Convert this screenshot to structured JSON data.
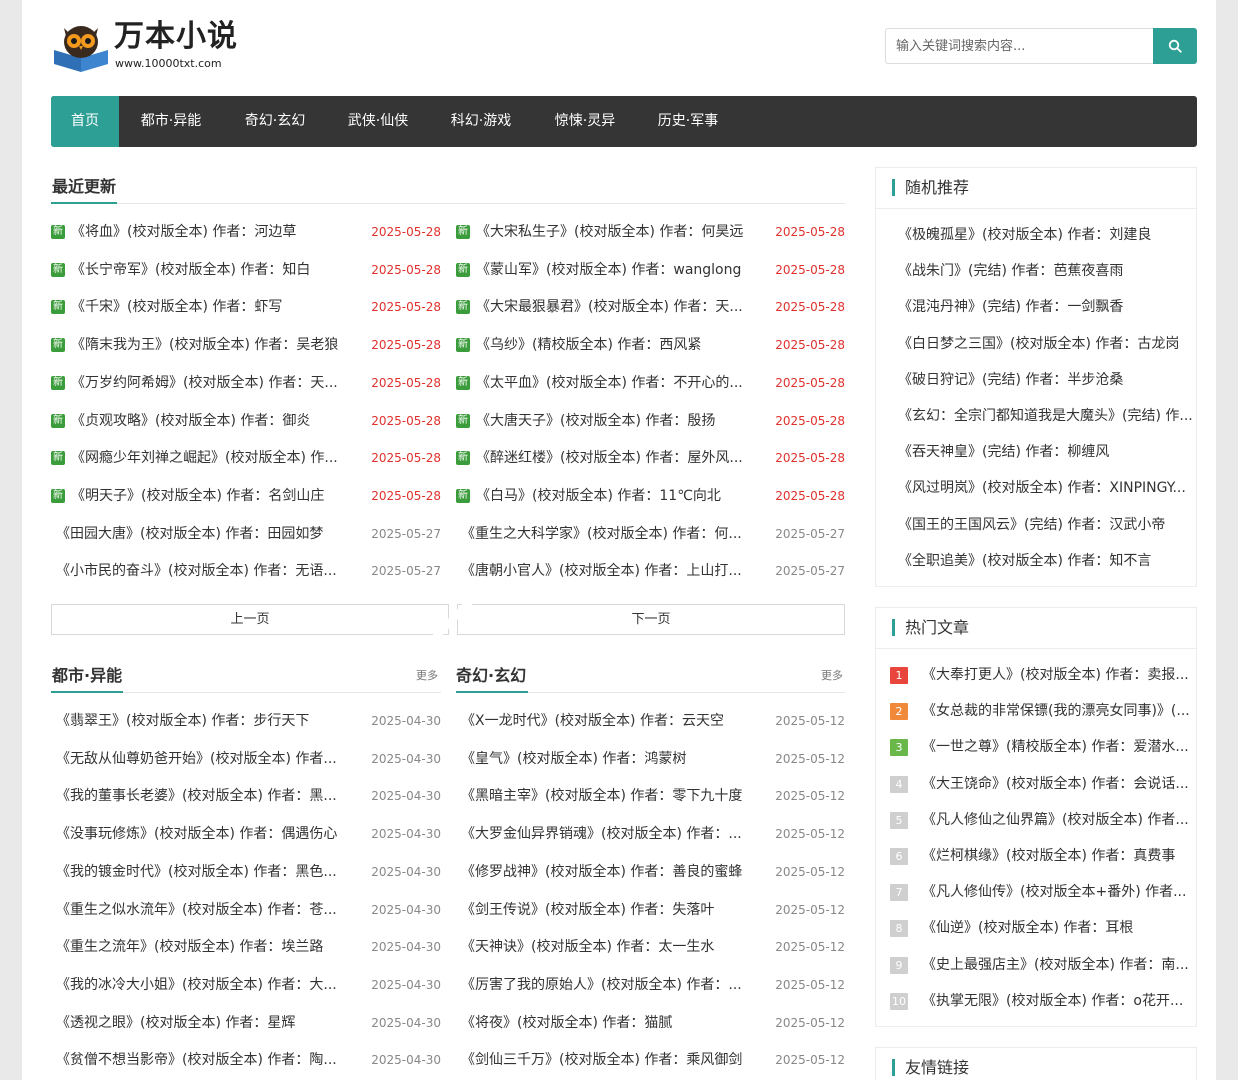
{
  "header": {
    "logo_title": "万本小说",
    "logo_url": "www.10000txt.com",
    "search_placeholder": "输入关键词搜索内容...",
    "colors": {
      "accent": "#2d9f94",
      "nav_bg": "#353535",
      "new_badge": "#3b9c3b",
      "date_red": "#e0312c"
    }
  },
  "nav": [
    {
      "label": "首页",
      "active": true
    },
    {
      "label": "都市·异能"
    },
    {
      "label": "奇幻·玄幻"
    },
    {
      "label": "武侠·仙侠"
    },
    {
      "label": "科幻·游戏"
    },
    {
      "label": "惊悚·灵异"
    },
    {
      "label": "历史·军事"
    }
  ],
  "recent": {
    "title": "最近更新",
    "badge": "新",
    "left": [
      {
        "title": "《将血》(校对版全本) 作者：河边草",
        "date": "2025-05-28",
        "new": true
      },
      {
        "title": "《长宁帝军》(校对版全本) 作者：知白",
        "date": "2025-05-28",
        "new": true
      },
      {
        "title": "《千宋》(校对版全本) 作者：虾写",
        "date": "2025-05-28",
        "new": true
      },
      {
        "title": "《隋末我为王》(校对版全本) 作者：吴老狼",
        "date": "2025-05-28",
        "new": true
      },
      {
        "title": "《万岁约阿希姆》(校对版全本) 作者：天...",
        "date": "2025-05-28",
        "new": true
      },
      {
        "title": "《贞观攻略》(校对版全本) 作者：御炎",
        "date": "2025-05-28",
        "new": true
      },
      {
        "title": "《网瘾少年刘禅之崛起》(校对版全本) 作...",
        "date": "2025-05-28",
        "new": true
      },
      {
        "title": "《明天子》(校对版全本) 作者：名剑山庄",
        "date": "2025-05-28",
        "new": true
      },
      {
        "title": "《田园大唐》(校对版全本) 作者：田园如梦",
        "date": "2025-05-27",
        "new": false
      },
      {
        "title": "《小市民的奋斗》(校对版全本) 作者：无语...",
        "date": "2025-05-27",
        "new": false
      }
    ],
    "right": [
      {
        "title": "《大宋私生子》(校对版全本) 作者：何昊远",
        "date": "2025-05-28",
        "new": true
      },
      {
        "title": "《蒙山军》(校对版全本) 作者：wanglong",
        "date": "2025-05-28",
        "new": true
      },
      {
        "title": "《大宋最狠暴君》(校对版全本) 作者：天...",
        "date": "2025-05-28",
        "new": true
      },
      {
        "title": "《乌纱》(精校版全本) 作者：西风紧",
        "date": "2025-05-28",
        "new": true
      },
      {
        "title": "《太平血》(校对版全本) 作者：不开心的...",
        "date": "2025-05-28",
        "new": true
      },
      {
        "title": "《大唐天子》(校对版全本) 作者：殷扬",
        "date": "2025-05-28",
        "new": true
      },
      {
        "title": "《醉迷红楼》(校对版全本) 作者：屋外风...",
        "date": "2025-05-28",
        "new": true
      },
      {
        "title": "《白马》(校对版全本) 作者：11℃向北",
        "date": "2025-05-28",
        "new": true
      },
      {
        "title": "《重生之大科学家》(校对版全本) 作者：何...",
        "date": "2025-05-27",
        "new": false
      },
      {
        "title": "《唐朝小官人》(校对版全本) 作者：上山打...",
        "date": "2025-05-27",
        "new": false
      }
    ],
    "prev_label": "上一页",
    "next_label": "下一页"
  },
  "urban": {
    "title": "都市·异能",
    "more": "更多",
    "items": [
      {
        "title": "《翡翠王》(校对版全本) 作者：步行天下",
        "date": "2025-04-30"
      },
      {
        "title": "《无敌从仙尊奶爸开始》(校对版全本) 作者...",
        "date": "2025-04-30"
      },
      {
        "title": "《我的董事长老婆》(校对版全本) 作者：黑...",
        "date": "2025-04-30"
      },
      {
        "title": "《没事玩修炼》(校对版全本) 作者：偶遇伤心",
        "date": "2025-04-30"
      },
      {
        "title": "《我的镀金时代》(校对版全本) 作者：黑色...",
        "date": "2025-04-30"
      },
      {
        "title": "《重生之似水流年》(校对版全本) 作者：苍...",
        "date": "2025-04-30"
      },
      {
        "title": "《重生之流年》(校对版全本) 作者：埃兰路",
        "date": "2025-04-30"
      },
      {
        "title": "《我的冰冷大小姐》(校对版全本) 作者：大...",
        "date": "2025-04-30"
      },
      {
        "title": "《透视之眼》(校对版全本) 作者：星辉",
        "date": "2025-04-30"
      },
      {
        "title": "《贫僧不想当影帝》(校对版全本) 作者：陶...",
        "date": "2025-04-30"
      }
    ]
  },
  "fantasy": {
    "title": "奇幻·玄幻",
    "more": "更多",
    "items": [
      {
        "title": "《X一龙时代》(校对版全本) 作者：云天空",
        "date": "2025-05-12"
      },
      {
        "title": "《皇气》(校对版全本) 作者：鸿蒙树",
        "date": "2025-05-12"
      },
      {
        "title": "《黑暗主宰》(校对版全本) 作者：零下九十度",
        "date": "2025-05-12"
      },
      {
        "title": "《大罗金仙异界销魂》(校对版全本) 作者：...",
        "date": "2025-05-12"
      },
      {
        "title": "《修罗战神》(校对版全本) 作者：善良的蜜蜂",
        "date": "2025-05-12"
      },
      {
        "title": "《剑王传说》(校对版全本) 作者：失落叶",
        "date": "2025-05-12"
      },
      {
        "title": "《天神诀》(校对版全本) 作者：太一生水",
        "date": "2025-05-12"
      },
      {
        "title": "《厉害了我的原始人》(校对版全本) 作者：...",
        "date": "2025-05-12"
      },
      {
        "title": "《将夜》(校对版全本) 作者：猫腻",
        "date": "2025-05-12"
      },
      {
        "title": "《剑仙三千万》(校对版全本) 作者：乘风御剑",
        "date": "2025-05-12"
      }
    ]
  },
  "random": {
    "title": "随机推荐",
    "items": [
      "《极魄孤星》(校对版全本) 作者：刘建良",
      "《战朱门》(完结) 作者：芭蕉夜喜雨",
      "《混沌丹神》(完结) 作者：一剑飘香",
      "《白日梦之三国》(校对版全本) 作者：古龙岗",
      "《破日狩记》(完结) 作者：半步沧桑",
      "《玄幻：全宗门都知道我是大魔头》(完结) 作...",
      "《吞天神皇》(完结) 作者：柳缠风",
      "《风过明岚》(校对版全本) 作者：XINPINGY...",
      "《国王的王国风云》(完结) 作者：汉武小帝",
      "《全职追美》(校对版全本) 作者：知不言"
    ]
  },
  "hot": {
    "title": "热门文章",
    "items": [
      {
        "rank": "1",
        "title": "《大奉打更人》(校对版全本) 作者：卖报...",
        "color": "#e8453c"
      },
      {
        "rank": "2",
        "title": "《女总裁的非常保镖(我的漂亮女同事)》(...",
        "color": "#f08a3a"
      },
      {
        "rank": "3",
        "title": "《一世之尊》(精校版全本) 作者：爱潜水...",
        "color": "#6ab84a"
      },
      {
        "rank": "4",
        "title": "《大王饶命》(校对版全本) 作者：会说话...",
        "color": "#cfcfcf"
      },
      {
        "rank": "5",
        "title": "《凡人修仙之仙界篇》(校对版全本) 作者...",
        "color": "#cfcfcf"
      },
      {
        "rank": "6",
        "title": "《烂柯棋缘》(校对版全本) 作者：真费事",
        "color": "#cfcfcf"
      },
      {
        "rank": "7",
        "title": "《凡人修仙传》(校对版全本+番外) 作者...",
        "color": "#cfcfcf"
      },
      {
        "rank": "8",
        "title": "《仙逆》(校对版全本) 作者：耳根",
        "color": "#cfcfcf"
      },
      {
        "rank": "9",
        "title": "《史上最强店主》(校对版全本) 作者：南...",
        "color": "#cfcfcf"
      },
      {
        "rank": "10",
        "title": "《执掌无限》(校对版全本) 作者：o花开...",
        "color": "#cfcfcf"
      }
    ]
  },
  "links": {
    "title": "友情链接"
  }
}
